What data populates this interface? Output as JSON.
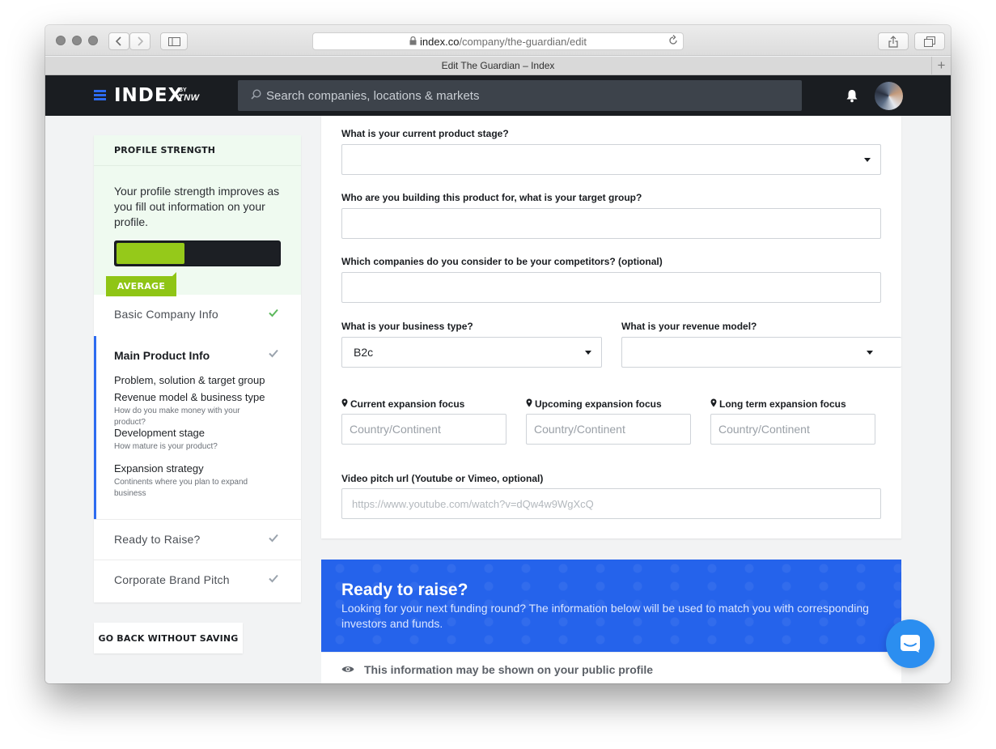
{
  "browser": {
    "url_host": "index.co",
    "url_path": "/company/the-guardian/edit",
    "tab_title": "Edit The Guardian – Index"
  },
  "header": {
    "logo": "INDEX",
    "logo_by": "BY",
    "logo_brand": "TNW",
    "search_placeholder": "Search companies, locations & markets"
  },
  "profile_strength": {
    "title": "PROFILE STRENGTH",
    "description": "Your profile strength improves as you fill out information on your profile.",
    "level": "AVERAGE",
    "progress": 0.42
  },
  "nav": {
    "basic": "Basic Company Info",
    "main": "Main Product Info",
    "main_items": [
      {
        "label": "Problem, solution & target group",
        "hint": ""
      },
      {
        "label": "Revenue model & business type",
        "hint": "How do you make money with your product?"
      },
      {
        "label": "Development stage",
        "hint": "How mature is your product?"
      },
      {
        "label": "Expansion strategy",
        "hint": "Continents where you plan to expand business"
      }
    ],
    "raise": "Ready to Raise?",
    "brand": "Corporate Brand Pitch"
  },
  "go_back_label": "GO BACK WITHOUT SAVING",
  "form": {
    "stage_label": "What is your current product stage?",
    "stage_value": "",
    "target_label": "Who are you building this product for, what is your target group?",
    "target_value": "",
    "competitors_label": "Which companies do you consider to be your competitors? (optional)",
    "competitors_value": "",
    "business_type_label": "What is your business type?",
    "business_type_value": "B2c",
    "revenue_label": "What is your revenue model?",
    "revenue_value": "",
    "current_exp_label": "Current expansion focus",
    "upcoming_exp_label": "Upcoming expansion focus",
    "longterm_exp_label": "Long term expansion focus",
    "country_placeholder": "Country/Continent",
    "video_label": "Video pitch url (Youtube or Vimeo, optional)",
    "video_placeholder": "https://www.youtube.com/watch?v=dQw4w9WgXcQ"
  },
  "raise": {
    "title": "Ready to raise?",
    "description": "Looking for your next funding round? The information below will be used to match you with corresponding investors and funds.",
    "public_note": "This information may be shown on your public profile"
  },
  "colors": {
    "accent": "#2563eb",
    "progress_fill": "#95c91a",
    "check_done": "#5cb85c",
    "check_pending": "#9aa3ad"
  }
}
